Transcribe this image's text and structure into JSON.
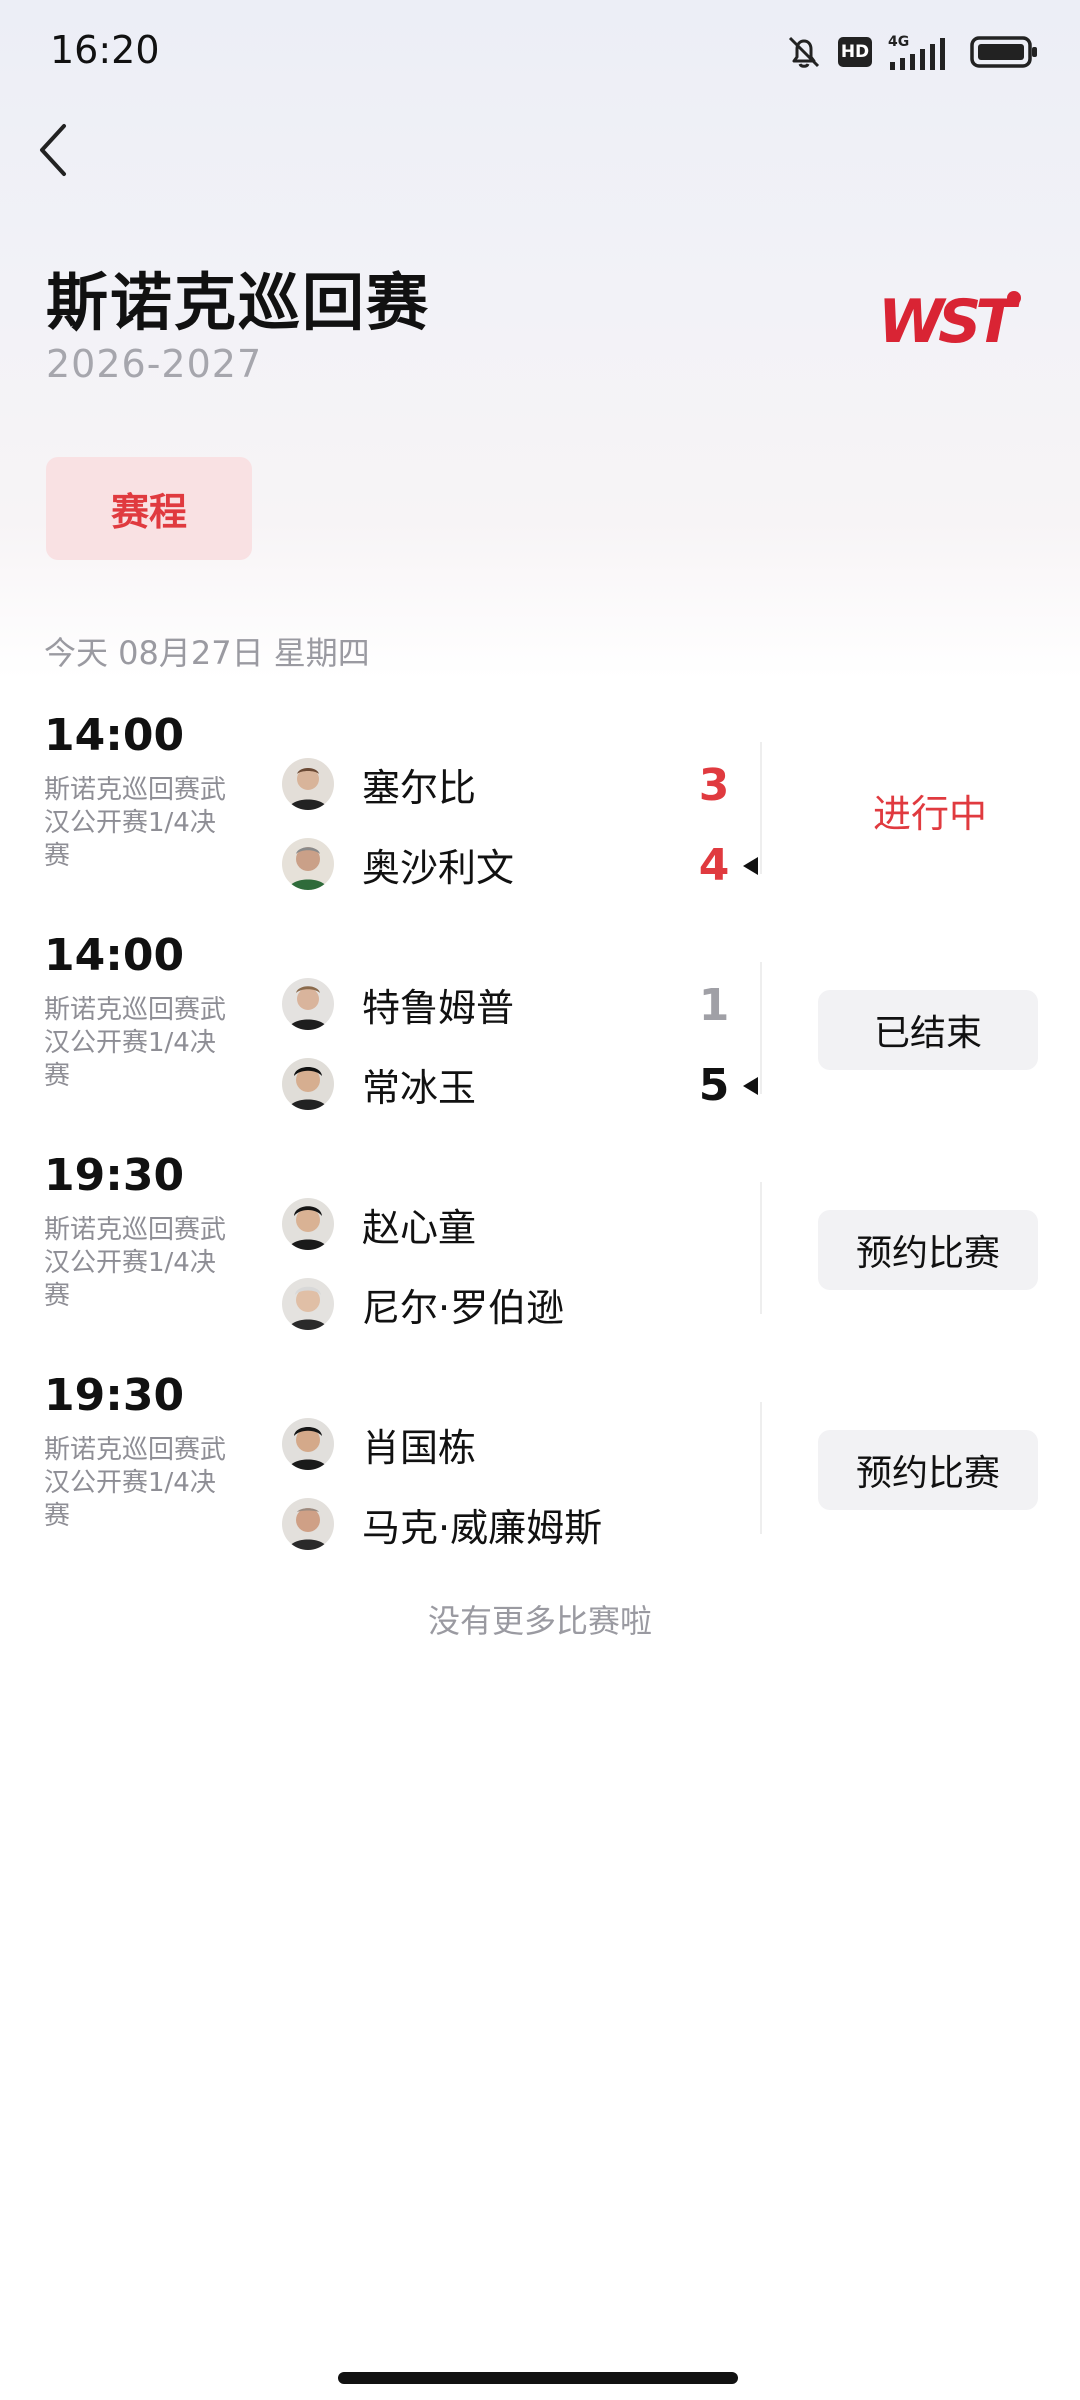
{
  "status_bar": {
    "time": "16:20",
    "network": "4G",
    "hd": "HD"
  },
  "header": {
    "title": "斯诺克巡回赛",
    "season": "2026-2027",
    "logo_text": "WST"
  },
  "tabs": [
    {
      "label": "赛程",
      "active": true
    }
  ],
  "date_header": "今天 08月27日 星期四",
  "matches": [
    {
      "time": "14:00",
      "event": "斯诺克巡回赛武汉公开赛1/4决赛",
      "players": [
        {
          "name": "塞尔比",
          "score": "3",
          "winner": false
        },
        {
          "name": "奥沙利文",
          "score": "4",
          "winner": true
        }
      ],
      "status": "进行中"
    },
    {
      "time": "14:00",
      "event": "斯诺克巡回赛武汉公开赛1/4决赛",
      "players": [
        {
          "name": "特鲁姆普",
          "score": "1",
          "winner": false
        },
        {
          "name": "常冰玉",
          "score": "5",
          "winner": true
        }
      ],
      "status": "已结束"
    },
    {
      "time": "19:30",
      "event": "斯诺克巡回赛武汉公开赛1/4决赛",
      "players": [
        {
          "name": "赵心童"
        },
        {
          "name": "尼尔·罗伯逊"
        }
      ],
      "status": "预约比赛"
    },
    {
      "time": "19:30",
      "event": "斯诺克巡回赛武汉公开赛1/4决赛",
      "players": [
        {
          "name": "肖国栋"
        },
        {
          "name": "马克·威廉姆斯"
        }
      ],
      "status": "预约比赛"
    }
  ],
  "footer_text": "没有更多比赛啦",
  "colors": {
    "accent": "#e03a3f",
    "tab_bg": "#f9e1e3",
    "muted": "#9a9aa1",
    "button_bg": "#f2f2f4"
  }
}
